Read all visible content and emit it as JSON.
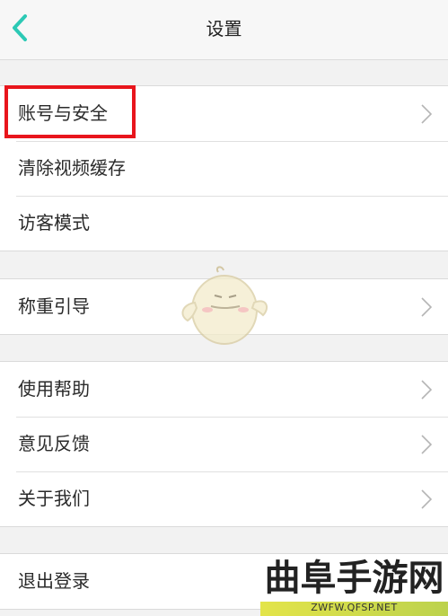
{
  "header": {
    "title": "设置",
    "back_icon": "chevron-left-icon",
    "accent_color": "#2cc9b5"
  },
  "groups": [
    {
      "items": [
        {
          "label": "账号与安全",
          "chevron": true,
          "highlighted": true
        },
        {
          "label": "清除视频缓存",
          "chevron": false
        },
        {
          "label": "访客模式",
          "chevron": false
        }
      ]
    },
    {
      "items": [
        {
          "label": "称重引导",
          "chevron": true
        }
      ]
    },
    {
      "items": [
        {
          "label": "使用帮助",
          "chevron": true
        },
        {
          "label": "意见反馈",
          "chevron": true
        },
        {
          "label": "关于我们",
          "chevron": true
        }
      ]
    },
    {
      "items": [
        {
          "label": "退出登录",
          "chevron": false
        }
      ]
    }
  ],
  "colors": {
    "highlight_border": "#e8151c",
    "chevron": "#b5b5b5"
  },
  "watermark": {
    "text": "曲阜手游网",
    "url": "ZWFW.QFSP.NET"
  }
}
